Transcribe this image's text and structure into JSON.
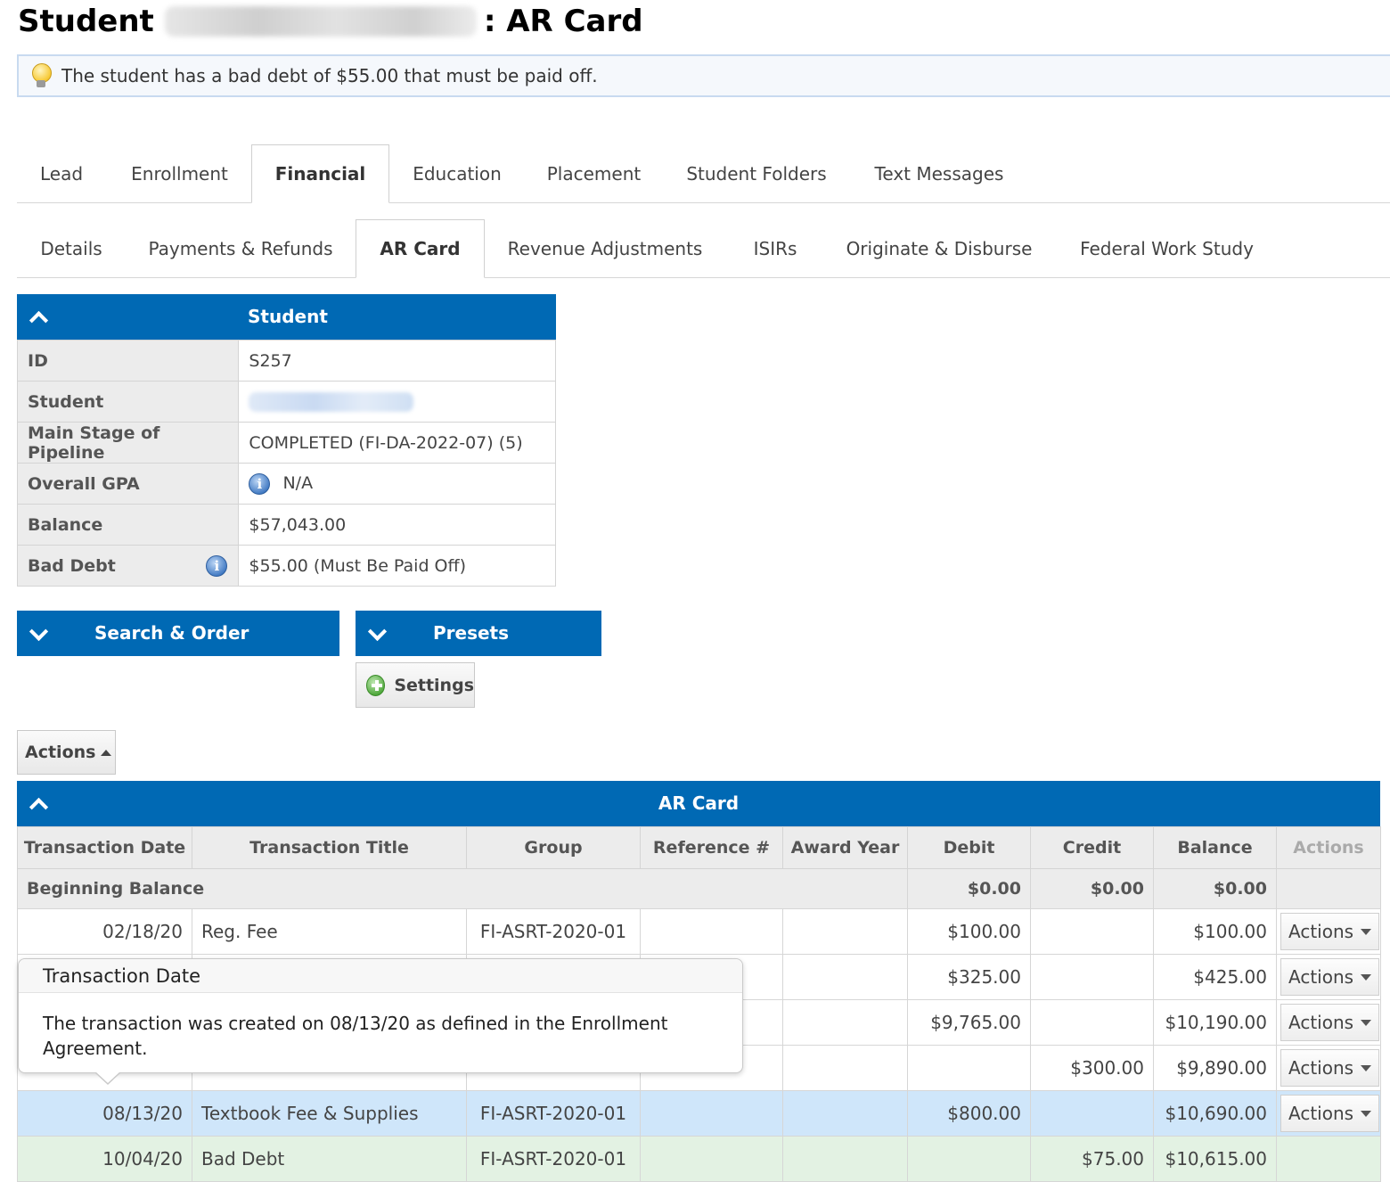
{
  "page": {
    "title_prefix": "Student",
    "title_suffix": ": AR Card"
  },
  "alert": {
    "icon": "lightbulb-icon",
    "text": "The student has a bad debt of $55.00 that must be paid off."
  },
  "main_tabs": [
    {
      "label": "Lead",
      "active": false
    },
    {
      "label": "Enrollment",
      "active": false
    },
    {
      "label": "Financial",
      "active": true
    },
    {
      "label": "Education",
      "active": false
    },
    {
      "label": "Placement",
      "active": false
    },
    {
      "label": "Student Folders",
      "active": false
    },
    {
      "label": "Text Messages",
      "active": false
    }
  ],
  "sub_tabs": [
    {
      "label": "Details",
      "active": false
    },
    {
      "label": "Payments & Refunds",
      "active": false
    },
    {
      "label": "AR Card",
      "active": true
    },
    {
      "label": "Revenue Adjustments",
      "active": false
    },
    {
      "label": "ISIRs",
      "active": false
    },
    {
      "label": "Originate & Disburse",
      "active": false
    },
    {
      "label": "Federal Work Study",
      "active": false
    }
  ],
  "student_panel": {
    "header": "Student",
    "rows": [
      {
        "label": "ID",
        "value": "S257"
      },
      {
        "label": "Student",
        "value": ""
      },
      {
        "label": "Main Stage of Pipeline",
        "value": "COMPLETED (FI-DA-2022-07) (5)"
      },
      {
        "label": "Overall GPA",
        "value": "N/A"
      },
      {
        "label": "Balance",
        "value": "$57,043.00"
      },
      {
        "label": "Bad Debt",
        "value": "$55.00 (Must Be Paid Off)"
      }
    ]
  },
  "search_order": {
    "label": "Search & Order"
  },
  "presets": {
    "label": "Presets",
    "settings_label": "Settings"
  },
  "actions_button": {
    "label": "Actions"
  },
  "ar_card": {
    "header": "AR Card",
    "columns": [
      "Transaction Date",
      "Transaction Title",
      "Group",
      "Reference #",
      "Award Year",
      "Debit",
      "Credit",
      "Balance",
      "Actions"
    ],
    "beginning": {
      "label": "Beginning Balance",
      "debit": "$0.00",
      "credit": "$0.00",
      "balance": "$0.00"
    },
    "rows": [
      {
        "date": "02/18/20",
        "title": "Reg. Fee",
        "group": "FI-ASRT-2020-01",
        "ref": "",
        "year": "",
        "debit": "$100.00",
        "credit": "",
        "balance": "$100.00",
        "action": "Actions"
      },
      {
        "date": "",
        "title": "",
        "group": "",
        "ref": "",
        "year": "",
        "debit": "$325.00",
        "credit": "",
        "balance": "$425.00",
        "action": "Actions"
      },
      {
        "date": "",
        "title": "",
        "group": "",
        "ref": "",
        "year": "",
        "debit": "$9,765.00",
        "credit": "",
        "balance": "$10,190.00",
        "action": "Actions"
      },
      {
        "date": "",
        "title": "",
        "group": "",
        "ref": "",
        "year": "",
        "debit": "",
        "credit": "$300.00",
        "balance": "$9,890.00",
        "action": "Actions"
      },
      {
        "date": "08/13/20",
        "title": "Textbook Fee & Supplies",
        "group": "FI-ASRT-2020-01",
        "ref": "",
        "year": "",
        "debit": "$800.00",
        "credit": "",
        "balance": "$10,690.00",
        "action": "Actions"
      },
      {
        "date": "10/04/20",
        "title": "Bad Debt",
        "group": "FI-ASRT-2020-01",
        "ref": "",
        "year": "",
        "debit": "",
        "credit": "$75.00",
        "balance": "$10,615.00",
        "action": ""
      }
    ]
  },
  "tooltip": {
    "title": "Transaction Date",
    "body": "The transaction was created on 08/13/20 as defined in the Enrollment Agreement."
  },
  "colors": {
    "primary_blue": "#0069b4",
    "link_blue": "#1565b0",
    "alert_red": "#c00000",
    "highlight_row": "#cfe6fa",
    "green_row": "#e3f2e3"
  }
}
